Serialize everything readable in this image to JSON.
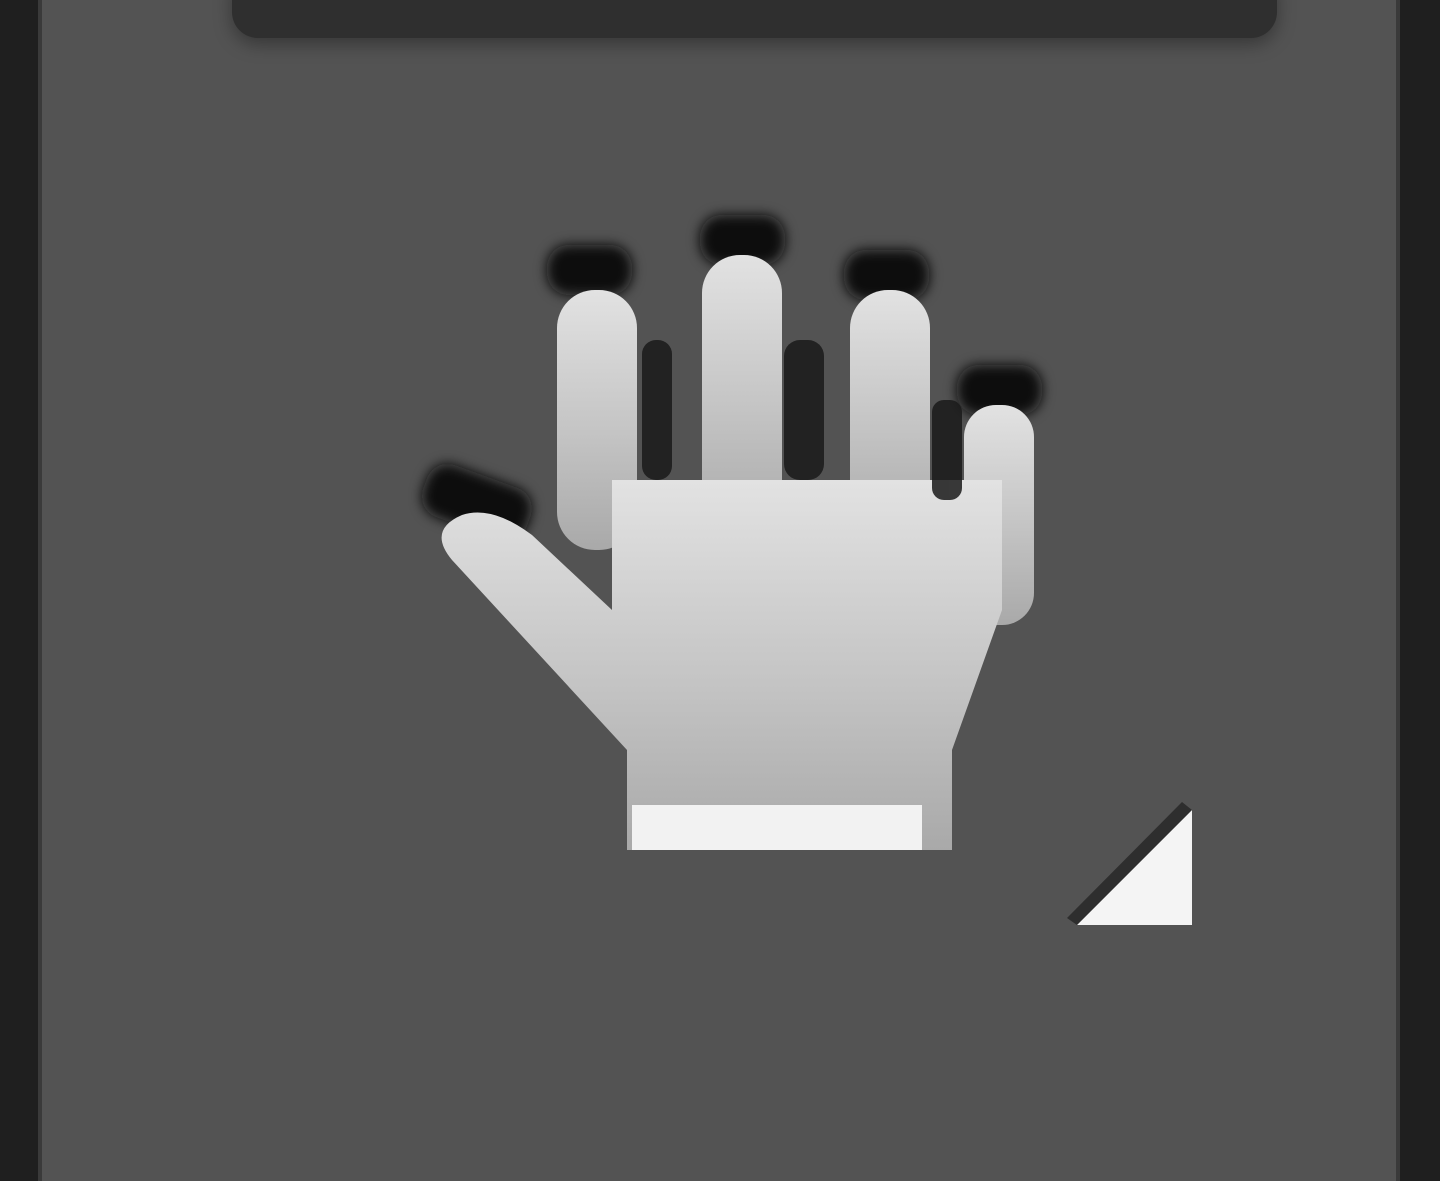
{
  "toolbar": {
    "tool": {
      "icon": "hand-icon",
      "has_flyout": true,
      "flyout_icon": "flyout-corner-triangle-icon"
    },
    "colors": {
      "panel_background": "#535353",
      "dark_edge": "#1f1f1f",
      "icon_fill": "#c8c8c8"
    }
  }
}
